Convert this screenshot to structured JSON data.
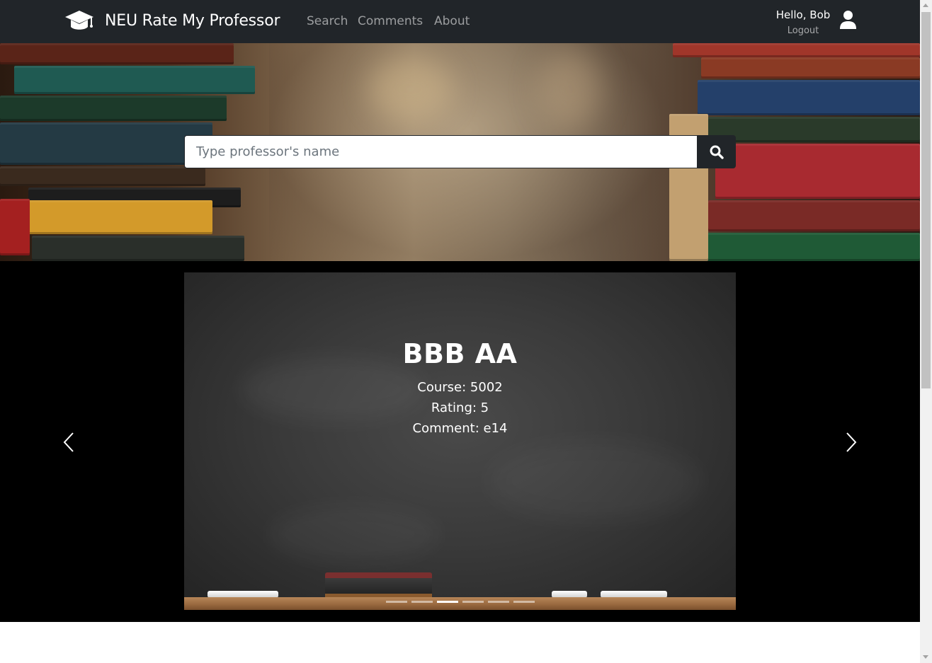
{
  "navbar": {
    "brand": "NEU Rate My Professor",
    "brand_icon": "graduation-cap-icon",
    "links": {
      "search": "Search",
      "comments": "Comments",
      "about": "About"
    },
    "greeting": "Hello, Bob",
    "logout": "Logout",
    "user_icon": "user-icon"
  },
  "hero": {
    "search_placeholder": "Type professor's name",
    "search_value": "",
    "search_button_icon": "search-icon"
  },
  "carousel": {
    "slide": {
      "professor": "BBB AA",
      "course": "Course: 5002",
      "rating": "Rating: 5",
      "comment": "Comment: e14"
    },
    "slide_count": 6,
    "active_index": 2,
    "prev_icon": "chevron-left-icon",
    "next_icon": "chevron-right-icon"
  },
  "colors": {
    "navbar": "#212529",
    "carousel_band": "#000000",
    "text_light": "#ffffff",
    "nav_link_muted": "rgba(255,255,255,0.55)"
  }
}
